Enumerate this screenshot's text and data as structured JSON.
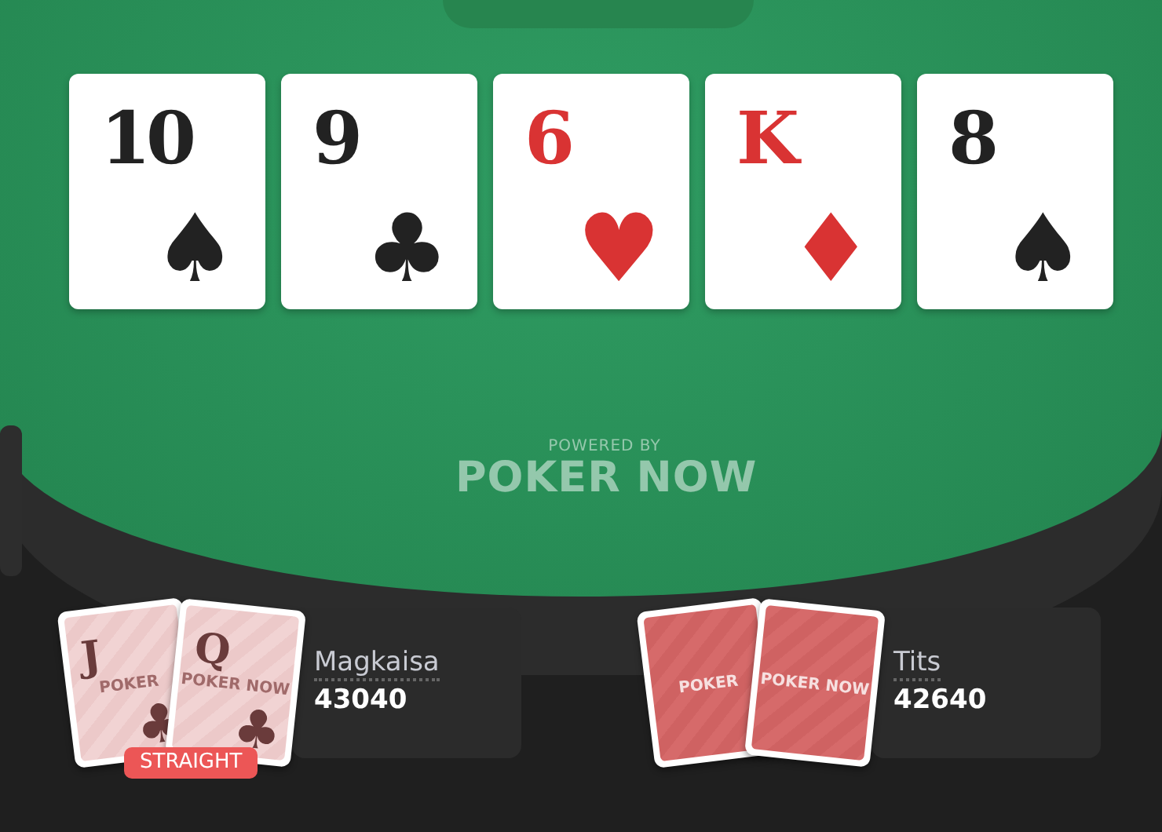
{
  "pot": {
    "kind": "pill"
  },
  "board": [
    {
      "rank": "10",
      "suit": "♠",
      "color": "#222222"
    },
    {
      "rank": "9",
      "suit": "♣",
      "color": "#222222"
    },
    {
      "rank": "6",
      "suit": "♥",
      "color": "#d93333"
    },
    {
      "rank": "K",
      "suit": "♦",
      "color": "#d93333"
    },
    {
      "rank": "8",
      "suit": "♠",
      "color": "#222222"
    }
  ],
  "logo": {
    "tagline": "POWERED BY",
    "name": "POKER NOW"
  },
  "players": [
    {
      "name": "Magkaisa",
      "stack": "43040",
      "hand_label": "STRAIGHT",
      "cards": [
        {
          "kind": "face",
          "rank": "J",
          "suit": "♣",
          "watermark": "POKER"
        },
        {
          "kind": "face",
          "rank": "Q",
          "suit": "♣",
          "watermark": "POKER NOW"
        }
      ]
    },
    {
      "name": "Tits",
      "stack": "42640",
      "cards": [
        {
          "kind": "back",
          "watermark": "POKER"
        },
        {
          "kind": "back",
          "watermark": "POKER NOW"
        }
      ]
    }
  ]
}
